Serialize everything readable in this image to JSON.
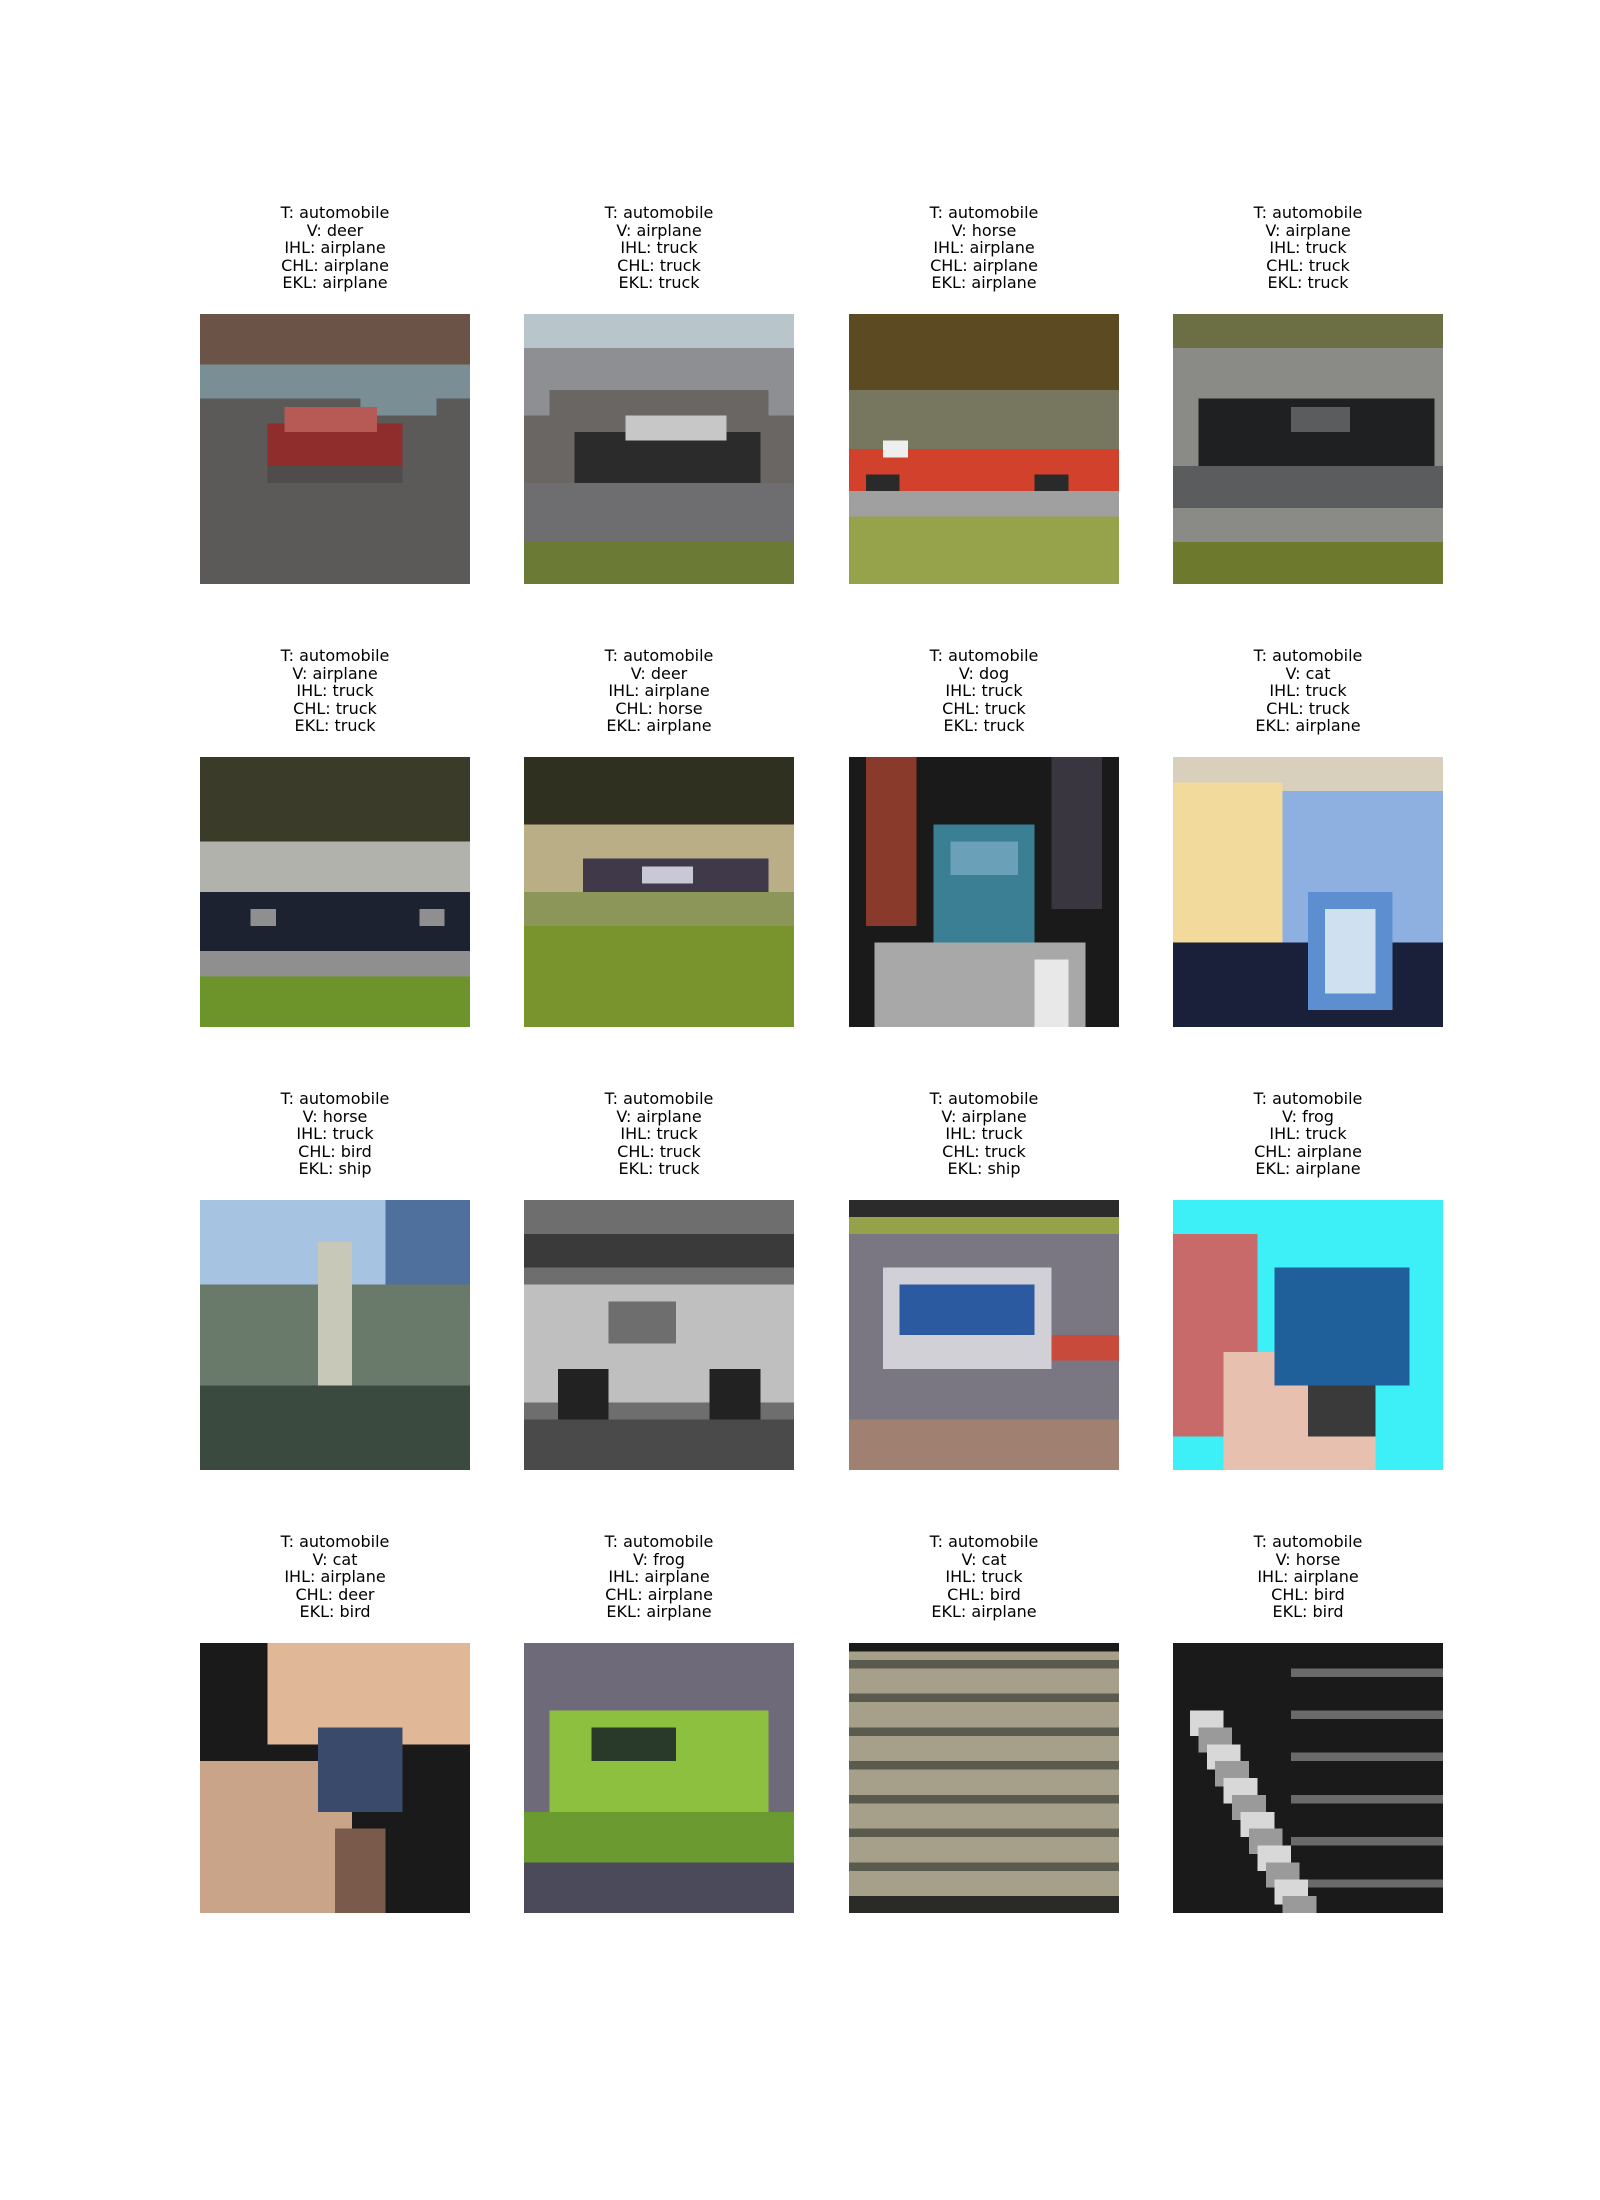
{
  "grid": {
    "rows": 4,
    "columns": 4,
    "panels": [
      {
        "true": "T: automobile",
        "v": "V: deer",
        "ihl": "IHL: airplane",
        "chl": "CHL: airplane",
        "ekl": "EKL: airplane",
        "scene": "red car on road, brown background",
        "palette": [
          "#6b5447",
          "#5c5a59",
          "#8e2d2c",
          "#7a8f95",
          "#4f4c4b"
        ]
      },
      {
        "true": "T: automobile",
        "v": "V: airplane",
        "ihl": "IHL: truck",
        "chl": "CHL: truck",
        "ekl": "EKL: truck",
        "scene": "dark car in front of grey buildings",
        "palette": [
          "#b8c6cc",
          "#6a6664",
          "#2b2b2b",
          "#c7c7c7",
          "#6b7a34"
        ]
      },
      {
        "true": "T: automobile",
        "v": "V: horse",
        "ihl": "IHL: airplane",
        "chl": "CHL: airplane",
        "ekl": "EKL: airplane",
        "scene": "red race car on grass",
        "palette": [
          "#5b4a22",
          "#76775e",
          "#d2412c",
          "#eeeeee",
          "#96a34a"
        ]
      },
      {
        "true": "T: automobile",
        "v": "V: airplane",
        "ihl": "IHL: truck",
        "chl": "CHL: truck",
        "ekl": "EKL: truck",
        "scene": "black car on grey road",
        "palette": [
          "#6c6e44",
          "#8a8a86",
          "#1f2022",
          "#5b5c5e",
          "#6d7a2d"
        ]
      },
      {
        "true": "T: automobile",
        "v": "V: airplane",
        "ihl": "IHL: truck",
        "chl": "CHL: truck",
        "ekl": "EKL: truck",
        "scene": "dark sedan on grass",
        "palette": [
          "#3b3b2a",
          "#b2b2ad",
          "#1c2230",
          "#8f8f8f",
          "#6c942a"
        ]
      },
      {
        "true": "T: automobile",
        "v": "V: deer",
        "ihl": "IHL: airplane",
        "chl": "CHL: horse",
        "ekl": "EKL: airplane",
        "scene": "small car far on green track",
        "palette": [
          "#2f3020",
          "#b9ae86",
          "#40394a",
          "#8c9659",
          "#7a942d"
        ]
      },
      {
        "true": "T: automobile",
        "v": "V: dog",
        "ihl": "IHL: truck",
        "chl": "CHL: truck",
        "ekl": "EKL: truck",
        "scene": "blue car with crowd",
        "palette": [
          "#1a1a1a",
          "#8a3a2a",
          "#3b7f95",
          "#a8a8a8",
          "#e8e8e8"
        ]
      },
      {
        "true": "T: automobile",
        "v": "V: cat",
        "ihl": "IHL: truck",
        "chl": "CHL: truck",
        "ekl": "EKL: airplane",
        "scene": "close-up of blue car and wheel",
        "palette": [
          "#d8d0bd",
          "#8eb0e0",
          "#f2d99c",
          "#1a1f3a",
          "#5d8fd0"
        ]
      },
      {
        "true": "T: automobile",
        "v": "V: horse",
        "ihl": "IHL: truck",
        "chl": "CHL: bird",
        "ekl": "EKL: ship",
        "scene": "abandoned car under blue sky",
        "palette": [
          "#a7c3e2",
          "#4f6f9c",
          "#6a7a6a",
          "#c8c8b8",
          "#3a4a3e"
        ]
      },
      {
        "true": "T: automobile",
        "v": "V: airplane",
        "ihl": "IHL: truck",
        "chl": "CHL: truck",
        "ekl": "EKL: truck",
        "scene": "grey pickup truck",
        "palette": [
          "#6e6e6e",
          "#3a3a3a",
          "#bfbfbf",
          "#222222",
          "#4a4a4a"
        ]
      },
      {
        "true": "T: automobile",
        "v": "V: airplane",
        "ihl": "IHL: truck",
        "chl": "CHL: truck",
        "ekl": "EKL: ship",
        "scene": "blue race car on track",
        "palette": [
          "#2b2b2b",
          "#96a24a",
          "#7a7682",
          "#2b5aa0",
          "#c84a3a"
        ]
      },
      {
        "true": "T: automobile",
        "v": "V: frog",
        "ihl": "IHL: truck",
        "chl": "CHL: airplane",
        "ekl": "EKL: airplane",
        "scene": "toy car in hand, cyan background",
        "palette": [
          "#3df0f8",
          "#c86a6a",
          "#1f5f9a",
          "#e8c0b0",
          "#3a3a3a"
        ]
      },
      {
        "true": "T: automobile",
        "v": "V: cat",
        "ihl": "IHL: airplane",
        "chl": "CHL: deer",
        "ekl": "EKL: bird",
        "scene": "hands close-up",
        "palette": [
          "#1a1a1a",
          "#e0b898",
          "#caa488",
          "#3a4a6a",
          "#7a5a4a"
        ]
      },
      {
        "true": "T: automobile",
        "v": "V: frog",
        "ihl": "IHL: airplane",
        "chl": "CHL: airplane",
        "ekl": "EKL: airplane",
        "scene": "lime green car",
        "palette": [
          "#6e6a7a",
          "#8ec040",
          "#6a9a30",
          "#2a3a2a",
          "#4a4a5a"
        ]
      },
      {
        "true": "T: automobile",
        "v": "V: cat",
        "ihl": "IHL: truck",
        "chl": "CHL: bird",
        "ekl": "EKL: airplane",
        "scene": "striped grille",
        "palette": [
          "#1a1a18",
          "#a6a08a",
          "#5a5a4e",
          "#2a2a26",
          "#7a7a6a"
        ]
      },
      {
        "true": "T: automobile",
        "v": "V: horse",
        "ihl": "IHL: airplane",
        "chl": "CHL: bird",
        "ekl": "EKL: bird",
        "scene": "tyre and grille in black and white",
        "palette": [
          "#1a1a1a",
          "#9a9a9a",
          "#d8d8d8",
          "#3a3a3a",
          "#6a6a6a"
        ]
      }
    ]
  }
}
